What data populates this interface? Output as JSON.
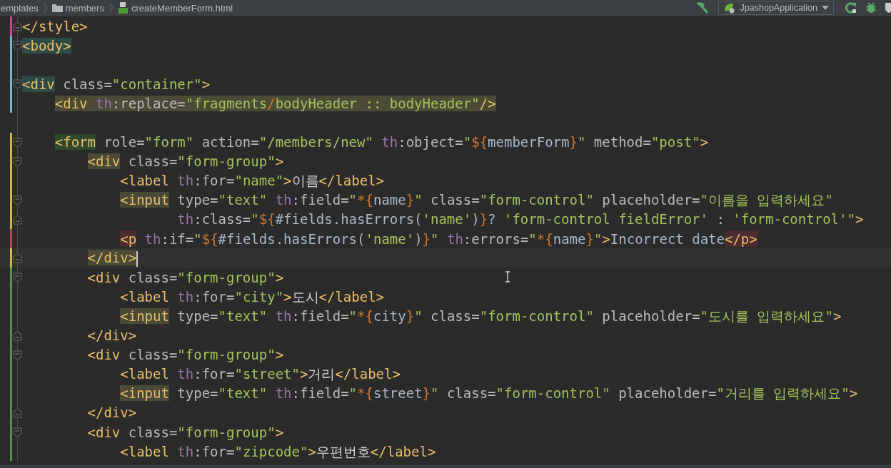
{
  "breadcrumbs": [
    {
      "kind": "plain",
      "label": "emplates"
    },
    {
      "kind": "folder",
      "label": "members"
    },
    {
      "kind": "html",
      "label": "createMemberForm.html"
    }
  ],
  "run_config": {
    "label": "JpashopApplication"
  },
  "lines": [
    {
      "color": "#c94a8a",
      "fold_start": false,
      "fold_end": true,
      "current": false,
      "tokens": [
        {
          "kind": "tag",
          "text": "</style>"
        }
      ]
    },
    {
      "color": "#6fb7c9",
      "fold_start": true,
      "fold_end": false,
      "current": false,
      "tokens": [
        {
          "kind": "tag",
          "text": "<body>",
          "color": "#2f4b47"
        }
      ]
    },
    {
      "kind": "blank",
      "color": "#6fb7c9"
    },
    {
      "color": "#6fb7c9",
      "fold_start": true,
      "fold_end": false,
      "current": false,
      "tokens": [
        {
          "kind": "tag",
          "text": "<div",
          "color": "#2f4b47"
        },
        {
          "kind": "attr",
          "text": " class="
        },
        {
          "kind": "str",
          "text": "\"container\""
        },
        {
          "kind": "tag",
          "text": ">"
        }
      ],
      "children": [
        {
          "color": "#6fb7c9",
          "fold_start": false,
          "fold_end": false,
          "current": false,
          "tokens": [
            {
              "kind": "tag",
              "text": "<div",
              "color": "#4b4a36"
            },
            {
              "kind": "ns",
              "text": " th",
              "color": "#4b4a36"
            },
            {
              "kind": "attr",
              "text": ":replace=",
              "color": "#4b4a36"
            },
            {
              "kind": "str",
              "text": "\"fragments",
              "color": "#4b4a36"
            },
            {
              "kind": "expr",
              "text": "/",
              "color": "#4b4a36"
            },
            {
              "kind": "str",
              "text": "bodyHeader :: bodyHeader\"",
              "color": "#4b4a36"
            },
            {
              "kind": "tag",
              "text": "/>",
              "color": "#4b4a36"
            }
          ]
        },
        {
          "kind": "blank"
        },
        {
          "color": "#c9b84a",
          "fold_start": true,
          "fold_end": false,
          "current": false,
          "tokens": [
            {
              "kind": "tag",
              "text": "<form",
              "color": "#2f4a2e"
            },
            {
              "kind": "attr",
              "text": " role="
            },
            {
              "kind": "str",
              "text": "\"form\""
            },
            {
              "kind": "attr",
              "text": " action="
            },
            {
              "kind": "str",
              "text": "\"/members/new\""
            },
            {
              "kind": "ns",
              "text": " th"
            },
            {
              "kind": "attr",
              "text": ":object="
            },
            {
              "kind": "str",
              "text": "\""
            },
            {
              "kind": "expr",
              "text": "${"
            },
            {
              "kind": "plain",
              "text": "memberForm"
            },
            {
              "kind": "expr",
              "text": "}"
            },
            {
              "kind": "str",
              "text": "\""
            },
            {
              "kind": "attr",
              "text": " method="
            },
            {
              "kind": "str",
              "text": "\"post\""
            },
            {
              "kind": "tag",
              "text": ">"
            }
          ],
          "children": [
            {
              "color": "#c9b84a",
              "fold_start": true,
              "fold_end": false,
              "current": false,
              "tokens": [
                {
                  "kind": "tag",
                  "text": "<div",
                  "color": "#4b4a36"
                },
                {
                  "kind": "attr",
                  "text": " class="
                },
                {
                  "kind": "str",
                  "text": "\"form-group\""
                },
                {
                  "kind": "tag",
                  "text": ">"
                }
              ],
              "children": [
                {
                  "color": "#c9b84a",
                  "fold_start": false,
                  "fold_end": false,
                  "current": false,
                  "tokens": [
                    {
                      "kind": "tag",
                      "text": "<label"
                    },
                    {
                      "kind": "ns",
                      "text": " th"
                    },
                    {
                      "kind": "attr",
                      "text": ":for="
                    },
                    {
                      "kind": "str",
                      "text": "\"name\""
                    },
                    {
                      "kind": "tag",
                      "text": ">"
                    },
                    {
                      "kind": "text",
                      "text": "이름"
                    },
                    {
                      "kind": "tag",
                      "text": "</label>"
                    }
                  ]
                },
                {
                  "color": "#c9b84a",
                  "fold_start": true,
                  "fold_end": false,
                  "current": false,
                  "tokens": [
                    {
                      "kind": "tag",
                      "text": "<input",
                      "color": "#4b4a36"
                    },
                    {
                      "kind": "attr",
                      "text": " type="
                    },
                    {
                      "kind": "str",
                      "text": "\"text\""
                    },
                    {
                      "kind": "ns",
                      "text": " th"
                    },
                    {
                      "kind": "attr",
                      "text": ":field="
                    },
                    {
                      "kind": "str",
                      "text": "\""
                    },
                    {
                      "kind": "expr",
                      "text": "*{"
                    },
                    {
                      "kind": "plain",
                      "text": "name"
                    },
                    {
                      "kind": "expr",
                      "text": "}"
                    },
                    {
                      "kind": "str",
                      "text": "\""
                    },
                    {
                      "kind": "attr",
                      "text": " class="
                    },
                    {
                      "kind": "str",
                      "text": "\"form-control\""
                    },
                    {
                      "kind": "attr",
                      "text": " placeholder="
                    },
                    {
                      "kind": "str",
                      "text": "\"이름을 입력하세요\""
                    }
                  ],
                  "children": [
                    {
                      "kind": "continuation",
                      "color": "#c9b84a",
                      "fold_start": false,
                      "fold_end": true,
                      "current": false,
                      "tokens": [
                        {
                          "kind": "ns",
                          "text": "th"
                        },
                        {
                          "kind": "attr",
                          "text": ":class="
                        },
                        {
                          "kind": "str",
                          "text": "\""
                        },
                        {
                          "kind": "expr",
                          "text": "${"
                        },
                        {
                          "kind": "plain",
                          "text": "#fields.hasErrors("
                        },
                        {
                          "kind": "str",
                          "text": "'name'"
                        },
                        {
                          "kind": "plain",
                          "text": ")"
                        },
                        {
                          "kind": "expr",
                          "text": "}"
                        },
                        {
                          "kind": "plain",
                          "text": "?"
                        },
                        {
                          "kind": "str",
                          "text": " 'form-control fieldError'"
                        },
                        {
                          "kind": "plain",
                          "text": " : "
                        },
                        {
                          "kind": "str",
                          "text": "'form-control'"
                        },
                        {
                          "kind": "str",
                          "text": "\""
                        },
                        {
                          "kind": "tag",
                          "text": ">"
                        }
                      ]
                    }
                  ]
                },
                {
                  "color": "#b04a5a",
                  "fold_start": false,
                  "fold_end": false,
                  "current": false,
                  "tokens": [
                    {
                      "kind": "tag",
                      "text": "<p",
                      "color": "#4b2b2b"
                    },
                    {
                      "kind": "ns",
                      "text": " th"
                    },
                    {
                      "kind": "attr",
                      "text": ":if="
                    },
                    {
                      "kind": "str",
                      "text": "\""
                    },
                    {
                      "kind": "expr",
                      "text": "${"
                    },
                    {
                      "kind": "plain",
                      "text": "#fields.hasErrors("
                    },
                    {
                      "kind": "str",
                      "text": "'name'"
                    },
                    {
                      "kind": "plain",
                      "text": ")"
                    },
                    {
                      "kind": "expr",
                      "text": "}"
                    },
                    {
                      "kind": "str",
                      "text": "\""
                    },
                    {
                      "kind": "ns",
                      "text": " th"
                    },
                    {
                      "kind": "attr",
                      "text": ":errors="
                    },
                    {
                      "kind": "str",
                      "text": "\""
                    },
                    {
                      "kind": "expr",
                      "text": "*{"
                    },
                    {
                      "kind": "plain",
                      "text": "name"
                    },
                    {
                      "kind": "expr",
                      "text": "}"
                    },
                    {
                      "kind": "str",
                      "text": "\""
                    },
                    {
                      "kind": "tag",
                      "text": ">"
                    },
                    {
                      "kind": "plain",
                      "text": "Incorrect date"
                    },
                    {
                      "kind": "tag",
                      "text": "</p>",
                      "color": "#4b2b2b"
                    }
                  ]
                }
              ]
            },
            {
              "color": "#c9b84a",
              "fold_start": false,
              "fold_end": true,
              "current": true,
              "tokens": [
                {
                  "kind": "tag",
                  "text": "</div>",
                  "color": "#4b4a36"
                }
              ]
            },
            {
              "color": "#4f9a3a",
              "fold_start": true,
              "fold_end": false,
              "current": false,
              "tokens": [
                {
                  "kind": "tag",
                  "text": "<div"
                },
                {
                  "kind": "attr",
                  "text": " class="
                },
                {
                  "kind": "str",
                  "text": "\"form-group\""
                },
                {
                  "kind": "tag",
                  "text": ">"
                }
              ],
              "children": [
                {
                  "color": "#4f9a3a",
                  "fold_start": false,
                  "fold_end": false,
                  "current": false,
                  "tokens": [
                    {
                      "kind": "tag",
                      "text": "<label"
                    },
                    {
                      "kind": "ns",
                      "text": " th"
                    },
                    {
                      "kind": "attr",
                      "text": ":for="
                    },
                    {
                      "kind": "str",
                      "text": "\"city\""
                    },
                    {
                      "kind": "tag",
                      "text": ">"
                    },
                    {
                      "kind": "text",
                      "text": "도시"
                    },
                    {
                      "kind": "tag",
                      "text": "</label>"
                    }
                  ]
                },
                {
                  "color": "#4f9a3a",
                  "fold_start": false,
                  "fold_end": false,
                  "current": false,
                  "tokens": [
                    {
                      "kind": "tag",
                      "text": "<input",
                      "color": "#4b4a36"
                    },
                    {
                      "kind": "attr",
                      "text": " type="
                    },
                    {
                      "kind": "str",
                      "text": "\"text\""
                    },
                    {
                      "kind": "ns",
                      "text": " th"
                    },
                    {
                      "kind": "attr",
                      "text": ":field="
                    },
                    {
                      "kind": "str",
                      "text": "\""
                    },
                    {
                      "kind": "expr",
                      "text": "*{"
                    },
                    {
                      "kind": "plain",
                      "text": "city"
                    },
                    {
                      "kind": "expr",
                      "text": "}"
                    },
                    {
                      "kind": "str",
                      "text": "\""
                    },
                    {
                      "kind": "attr",
                      "text": " class="
                    },
                    {
                      "kind": "str",
                      "text": "\"form-control\""
                    },
                    {
                      "kind": "attr",
                      "text": " placeholder="
                    },
                    {
                      "kind": "str",
                      "text": "\"도시를 입력하세요\""
                    },
                    {
                      "kind": "tag",
                      "text": ">"
                    }
                  ]
                }
              ]
            },
            {
              "color": "#4f9a3a",
              "fold_start": false,
              "fold_end": true,
              "current": false,
              "tokens": [
                {
                  "kind": "tag",
                  "text": "</div>"
                }
              ]
            },
            {
              "color": "#4f9a3a",
              "fold_start": true,
              "fold_end": false,
              "current": false,
              "tokens": [
                {
                  "kind": "tag",
                  "text": "<div"
                },
                {
                  "kind": "attr",
                  "text": " class="
                },
                {
                  "kind": "str",
                  "text": "\"form-group\""
                },
                {
                  "kind": "tag",
                  "text": ">"
                }
              ],
              "children": [
                {
                  "color": "#4f9a3a",
                  "fold_start": false,
                  "fold_end": false,
                  "current": false,
                  "tokens": [
                    {
                      "kind": "tag",
                      "text": "<label"
                    },
                    {
                      "kind": "ns",
                      "text": " th"
                    },
                    {
                      "kind": "attr",
                      "text": ":for="
                    },
                    {
                      "kind": "str",
                      "text": "\"street\""
                    },
                    {
                      "kind": "tag",
                      "text": ">"
                    },
                    {
                      "kind": "text",
                      "text": "거리"
                    },
                    {
                      "kind": "tag",
                      "text": "</label>"
                    }
                  ]
                },
                {
                  "color": "#4f9a3a",
                  "fold_start": false,
                  "fold_end": false,
                  "current": false,
                  "tokens": [
                    {
                      "kind": "tag",
                      "text": "<input",
                      "color": "#4b4a36"
                    },
                    {
                      "kind": "attr",
                      "text": " type="
                    },
                    {
                      "kind": "str",
                      "text": "\"text\""
                    },
                    {
                      "kind": "ns",
                      "text": " th"
                    },
                    {
                      "kind": "attr",
                      "text": ":field="
                    },
                    {
                      "kind": "str",
                      "text": "\""
                    },
                    {
                      "kind": "expr",
                      "text": "*{"
                    },
                    {
                      "kind": "plain",
                      "text": "street"
                    },
                    {
                      "kind": "expr",
                      "text": "}"
                    },
                    {
                      "kind": "str",
                      "text": "\""
                    },
                    {
                      "kind": "attr",
                      "text": " class="
                    },
                    {
                      "kind": "str",
                      "text": "\"form-control\""
                    },
                    {
                      "kind": "attr",
                      "text": " placeholder="
                    },
                    {
                      "kind": "str",
                      "text": "\"거리를 입력하세요\""
                    },
                    {
                      "kind": "tag",
                      "text": ">"
                    }
                  ]
                }
              ]
            },
            {
              "color": "#4f9a3a",
              "fold_start": false,
              "fold_end": true,
              "current": false,
              "tokens": [
                {
                  "kind": "tag",
                  "text": "</div>"
                }
              ]
            },
            {
              "color": "#4f9a3a",
              "fold_start": true,
              "fold_end": false,
              "current": false,
              "tokens": [
                {
                  "kind": "tag",
                  "text": "<div"
                },
                {
                  "kind": "attr",
                  "text": " class="
                },
                {
                  "kind": "str",
                  "text": "\"form-group\""
                },
                {
                  "kind": "tag",
                  "text": ">"
                }
              ],
              "children": [
                {
                  "color": "#4f9a3a",
                  "fold_start": false,
                  "fold_end": false,
                  "current": false,
                  "tokens": [
                    {
                      "kind": "tag",
                      "text": "<label"
                    },
                    {
                      "kind": "ns",
                      "text": " th"
                    },
                    {
                      "kind": "attr",
                      "text": ":for="
                    },
                    {
                      "kind": "str",
                      "text": "\"zipcode\""
                    },
                    {
                      "kind": "tag",
                      "text": ">"
                    },
                    {
                      "kind": "text",
                      "text": "우편번호"
                    },
                    {
                      "kind": "tag",
                      "text": "</label>"
                    }
                  ]
                }
              ]
            }
          ]
        }
      ]
    }
  ]
}
